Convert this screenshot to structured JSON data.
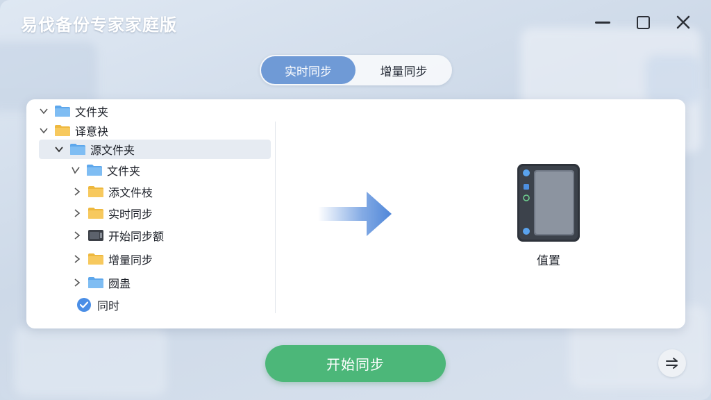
{
  "window": {
    "title": "易伐备份专家家庭版"
  },
  "mode_toggle": {
    "active": "实时同步",
    "inactive": "增量同步"
  },
  "tree": {
    "items": [
      {
        "label": "文件夹",
        "level": "root",
        "expanded": true,
        "folder_color": "blue"
      },
      {
        "label": "译意袂",
        "level": "root",
        "expanded": true,
        "folder_color": "yellow"
      },
      {
        "label": "源文件夹",
        "level": "child",
        "expanded": true,
        "selected": true,
        "folder_color": "blue"
      },
      {
        "label": "文件夹",
        "level": "grandchild",
        "expanded": true,
        "folder_color": "blue"
      },
      {
        "label": "添文件枝",
        "level": "grandchild",
        "expanded": false,
        "folder_color": "yellow"
      },
      {
        "label": "实时同步",
        "level": "grandchild",
        "expanded": false,
        "folder_color": "yellow"
      },
      {
        "label": "开始同步额",
        "level": "grandchild",
        "expanded": false,
        "folder_color": "dark"
      },
      {
        "label": "增量同步",
        "level": "grandchild",
        "expanded": false,
        "folder_color": "yellow"
      },
      {
        "label": "囫蛊",
        "level": "grandchild",
        "expanded": false,
        "folder_color": "blue"
      },
      {
        "label": "同时",
        "level": "grandchild",
        "checked": true
      }
    ]
  },
  "destination": {
    "label": "值置",
    "icon": "tablet-device-icon"
  },
  "start_button": {
    "label": "开始同步"
  },
  "colors": {
    "accent": "#6f9ad6",
    "start_green": "#4cb779",
    "folder_blue": "#6fb3ef",
    "folder_yellow": "#f7c757"
  }
}
